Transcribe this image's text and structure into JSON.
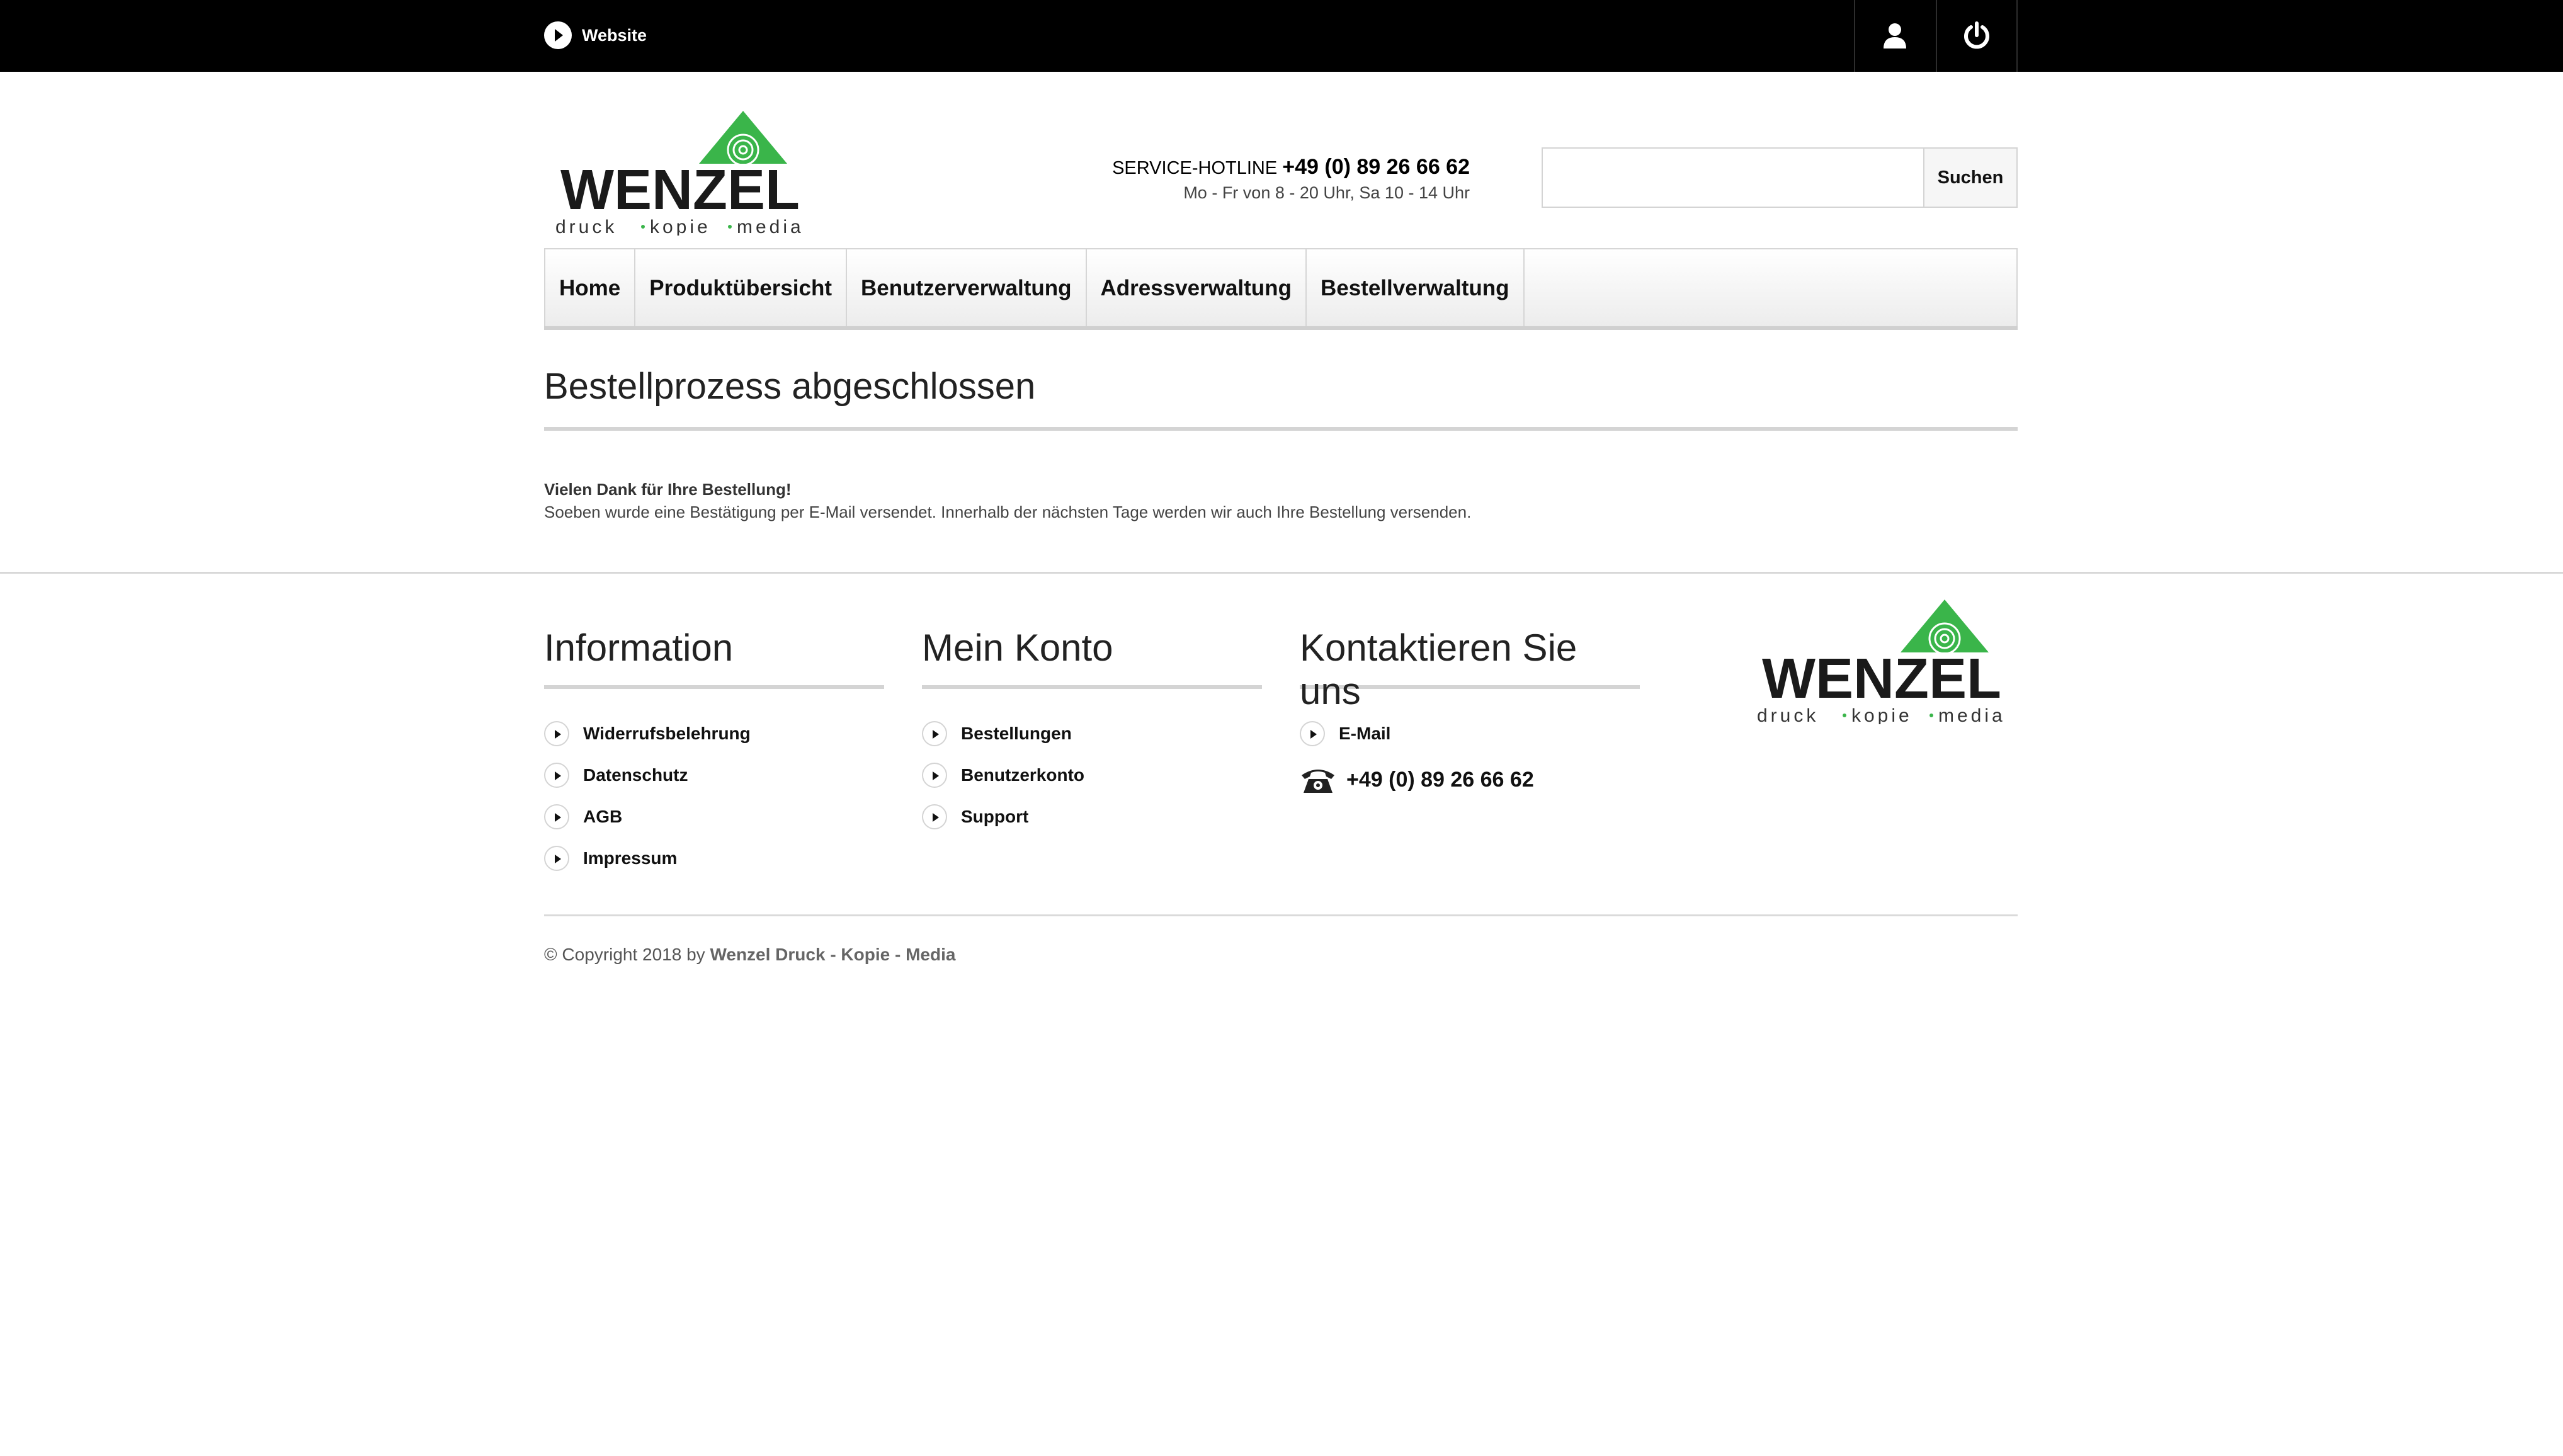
{
  "topbar": {
    "website_label": "Website",
    "user_icon": "user-icon",
    "power_icon": "power-icon"
  },
  "logo": {
    "name": "WENZEL",
    "tagline_1": "druck",
    "tagline_2": "kopie",
    "tagline_3": "media",
    "brand_green": "#3ab54a"
  },
  "hotline": {
    "label": "SERVICE-HOTLINE",
    "number": "+49 (0) 89 26 66 62",
    "hours": "Mo - Fr von 8 - 20 Uhr, Sa 10 - 14 Uhr"
  },
  "search": {
    "value": "",
    "button_label": "Suchen"
  },
  "nav": {
    "items": [
      {
        "label": "Home"
      },
      {
        "label": "Produktübersicht"
      },
      {
        "label": "Benutzerverwaltung"
      },
      {
        "label": "Adressverwaltung"
      },
      {
        "label": "Bestellverwaltung"
      }
    ]
  },
  "main": {
    "title": "Bestellprozess abgeschlossen",
    "thanks": "Vielen Dank für Ihre Bestellung!",
    "message": "Soeben wurde eine Bestätigung per E-Mail versendet. Innerhalb der nächsten Tage werden wir auch Ihre Bestellung versenden."
  },
  "footer": {
    "information": {
      "title": "Information",
      "items": [
        "Widerrufsbelehrung",
        "Datenschutz",
        "AGB",
        "Impressum"
      ]
    },
    "account": {
      "title": "Mein Konto",
      "items": [
        "Bestellungen",
        "Benutzerkonto",
        "Support"
      ]
    },
    "contact": {
      "title": "Kontaktieren Sie uns",
      "email_label": "E-Mail",
      "phone": "+49 (0) 89 26 66 62"
    },
    "copyright_prefix": "© Copyright 2018 by",
    "copyright_company": "Wenzel Druck - Kopie - Media"
  }
}
